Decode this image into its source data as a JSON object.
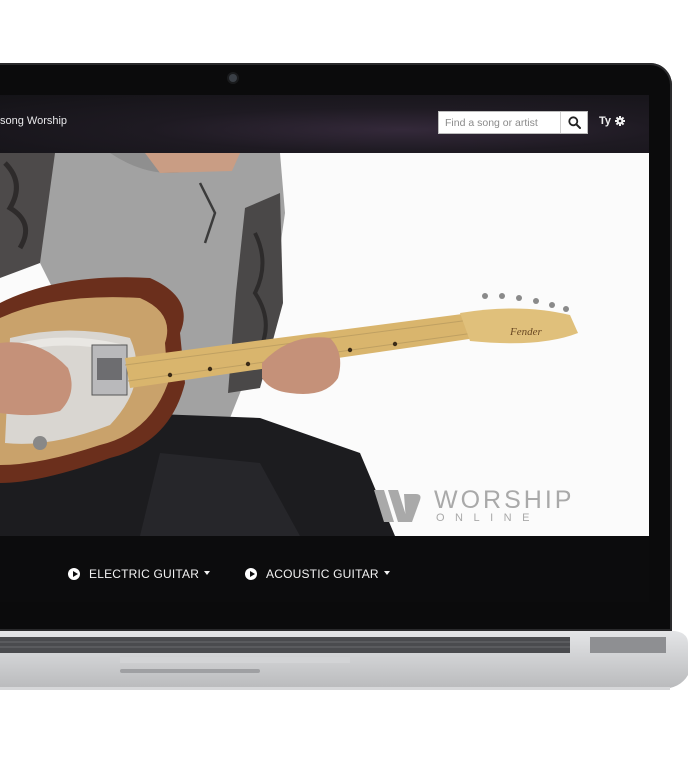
{
  "header": {
    "site_title": "song Worship",
    "search_placeholder": "Find a song or artist",
    "user_label": "Ty"
  },
  "video": {
    "watermark": {
      "word": "WORSHIP",
      "sub": "ONLINE"
    }
  },
  "instruments": [
    {
      "label": "ELECTRIC GUITAR"
    },
    {
      "label": "ACOUSTIC GUITAR"
    }
  ],
  "icons": [
    "search-icon",
    "gear-icon",
    "play-icon",
    "caret-down-icon",
    "camera-icon",
    "worship-online-logo-icon"
  ],
  "colors": {
    "bezel": "#0b0b0c",
    "topbar": "#1e1a22",
    "bottombar": "#0c0c0d",
    "laptop_body": "#c9cacc"
  }
}
